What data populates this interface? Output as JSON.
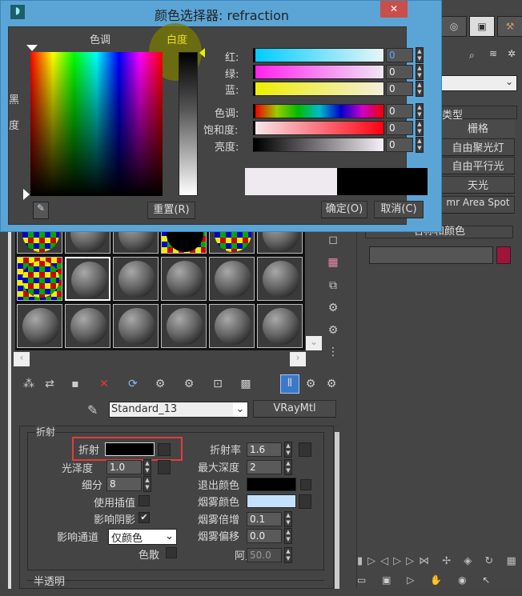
{
  "dialog": {
    "title": "颜色选择器: refraction",
    "close": "✕",
    "hue_label": "色调",
    "whiteness_label": "白度",
    "blackness_label": [
      "黑",
      "度"
    ],
    "sliders": [
      {
        "label": "红:",
        "value": "0"
      },
      {
        "label": "绿:",
        "value": "0"
      },
      {
        "label": "蓝:",
        "value": "0"
      },
      {
        "label": "色调:",
        "value": "0"
      },
      {
        "label": "饱和度:",
        "value": "0"
      },
      {
        "label": "亮度:",
        "value": "0"
      }
    ],
    "reset": "重置(R)",
    "ok": "确定(O)",
    "cancel": "取消(C)",
    "colors": {
      "old": "#efeaf0",
      "new": "#000000",
      "titlebar": "#5ba5d6"
    }
  },
  "material": {
    "name": "Standard_13",
    "type": "VRayMtl",
    "group_title": "折射",
    "refraction_label": "折射",
    "glossiness_label": "光泽度",
    "glossiness": "1.0",
    "subdivs_label": "细分",
    "subdivs": "8",
    "use_interp_label": "使用插值",
    "affect_shadows_label": "影响阴影",
    "affect_channels_label": "影响通道",
    "affect_channels": "仅颜色",
    "dispersion_label": "色散",
    "ior_label": "折射率",
    "ior": "1.6",
    "max_depth_label": "最大深度",
    "max_depth": "2",
    "exit_color_label": "退出颜色",
    "fog_color_label": "烟雾颜色",
    "fog_mult_label": "烟雾倍增",
    "fog_mult": "0.1",
    "fog_bias_label": "烟雾偏移",
    "fog_bias": "0.0",
    "abbe_label": "阿贝",
    "abbe": "50.0",
    "translucency_title": "半透明",
    "fog_color": "#c4e0ff"
  },
  "command_panel": {
    "rollout_type": "类型",
    "buttons": [
      "栅格",
      "自由聚光灯",
      "自由平行光",
      "天光",
      "mr Area Spot"
    ],
    "name_color_title": "名称和颜色",
    "object_color": "#a0143a"
  }
}
